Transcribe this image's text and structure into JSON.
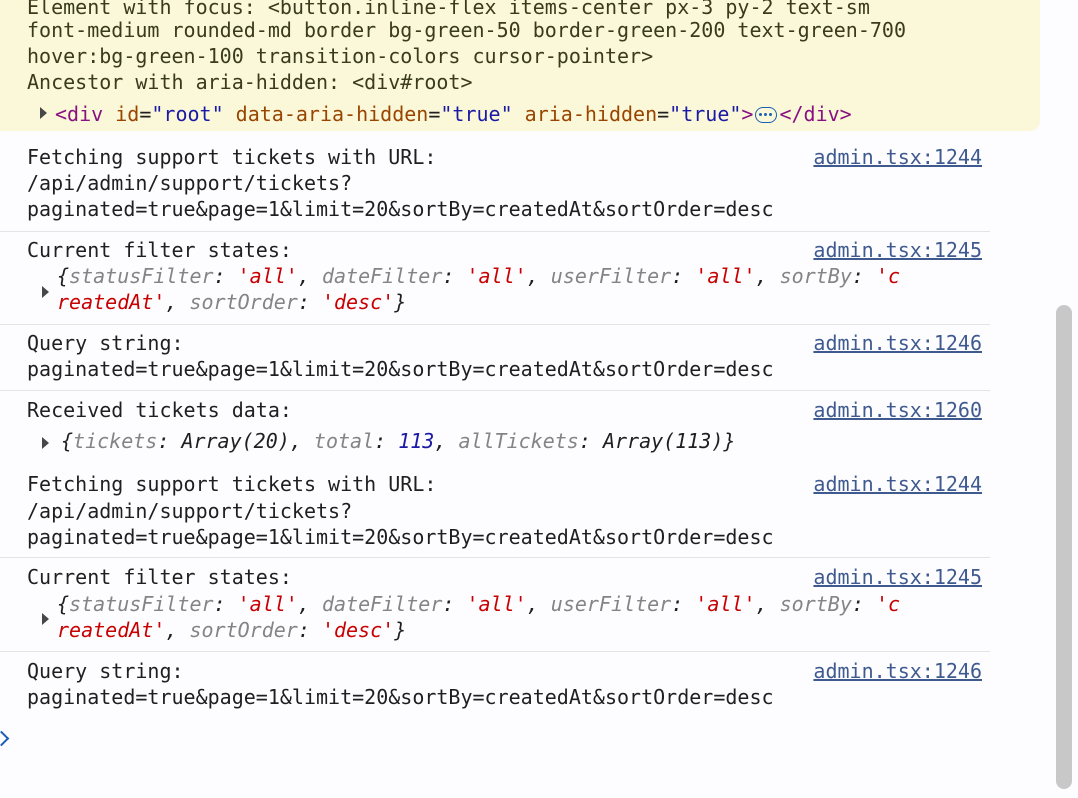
{
  "warning": {
    "line1": "Element with focus: <button.inline-flex items-center px-3 py-2 text-sm",
    "line2": "font-medium rounded-md border bg-green-50 border-green-200 text-green-700",
    "line3": "hover:bg-green-100 transition-colors cursor-pointer>",
    "line4": "Ancestor with aria-hidden: <div#root>",
    "element": {
      "open_tag": "<div",
      "attr1_name": "id",
      "attr1_value": "\"root\"",
      "attr2_name": "data-aria-hidden",
      "attr2_value": "\"true\"",
      "attr3_name": "aria-hidden",
      "attr3_value": "\"true\"",
      "close_bracket": ">",
      "close_tag": "</div>"
    }
  },
  "messages": [
    {
      "line1": "Fetching support tickets with URL:",
      "line2": "/api/admin/support/tickets?",
      "line3": "paginated=true&page=1&limit=20&sortBy=createdAt&sortOrder=desc",
      "source": "admin.tsx:1244"
    },
    {
      "line1": "Current filter states:",
      "source": "admin.tsx:1245",
      "obj_line2_end": "reatedAt",
      "obj": {
        "k1": "statusFilter",
        "v1": "'all'",
        "k2": "dateFilter",
        "v2": "'all'",
        "k3": "userFilter",
        "v3": "'all'",
        "k4": "sortBy",
        "v4a": "'c",
        "v4b": "reatedAt'",
        "k5": "sortOrder",
        "v5": "'desc'"
      }
    },
    {
      "line1": "Query string:",
      "line2": "paginated=true&page=1&limit=20&sortBy=createdAt&sortOrder=desc",
      "source": "admin.tsx:1246"
    },
    {
      "line1": "Received tickets data:",
      "source": "admin.tsx:1260",
      "obj": {
        "k1": "tickets",
        "v1": "Array(20)",
        "k2": "total",
        "v2": "113",
        "k3": "allTickets",
        "v3": "Array(113)"
      }
    },
    {
      "line1": "Fetching support tickets with URL:",
      "line2": "/api/admin/support/tickets?",
      "line3": "paginated=true&page=1&limit=20&sortBy=createdAt&sortOrder=desc",
      "source": "admin.tsx:1244"
    },
    {
      "line1": "Current filter states:",
      "source": "admin.tsx:1245",
      "obj": {
        "k1": "statusFilter",
        "v1": "'all'",
        "k2": "dateFilter",
        "v2": "'all'",
        "k3": "userFilter",
        "v3": "'all'",
        "k4": "sortBy",
        "v4a": "'c",
        "v4b": "reatedAt'",
        "k5": "sortOrder",
        "v5": "'desc'"
      }
    },
    {
      "line1": "Query string:",
      "line2": "paginated=true&page=1&limit=20&sortBy=createdAt&sortOrder=desc",
      "source": "admin.tsx:1246"
    }
  ],
  "colors": {
    "warning_bg": "#fbf8d9",
    "link": "#3e5a8f",
    "string": "#c80000",
    "number": "#1a1aa6",
    "key": "#848484"
  }
}
